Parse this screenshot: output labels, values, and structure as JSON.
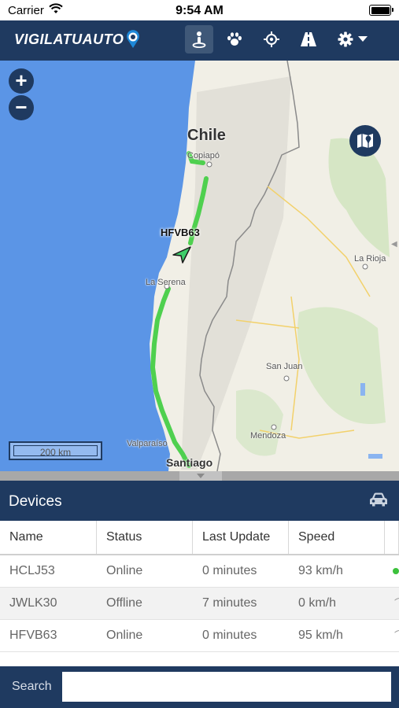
{
  "status_bar": {
    "carrier": "Carrier",
    "time": "9:54 AM"
  },
  "app": {
    "logo_text": "VIGILATUAUTO"
  },
  "nav": {
    "icons": [
      "tracking-person-icon",
      "paw-icon",
      "crosshair-icon",
      "road-icon",
      "gear-icon",
      "caret-down-icon"
    ],
    "active": "tracking-person-icon"
  },
  "map": {
    "zoom_in": "+",
    "zoom_out": "−",
    "scale_label": "200 km",
    "labels": {
      "chile": "Chile",
      "copiapo": "Copiapó",
      "la_serena": "La Serena",
      "la_rioja": "La Rioja",
      "san_juan": "San Juan",
      "mendoza": "Mendoza",
      "valparaiso": "Valparaíso",
      "santiago": "Santiago"
    },
    "vehicle_label": "HFVB63"
  },
  "devices": {
    "title": "Devices",
    "columns": [
      "Name",
      "Status",
      "Last Update",
      "Speed"
    ],
    "rows": [
      {
        "name": "HCLJ53",
        "status": "Online",
        "last_update": "0 minutes",
        "speed": "93 km/h"
      },
      {
        "name": "JWLK30",
        "status": "Offline",
        "last_update": "7 minutes",
        "speed": "0 km/h"
      },
      {
        "name": "HFVB63",
        "status": "Online",
        "last_update": "0 minutes",
        "speed": "95 km/h"
      }
    ]
  },
  "search": {
    "label": "Search",
    "value": "",
    "placeholder": ""
  },
  "colors": {
    "navy": "#1f3a60",
    "ocean": "#5b95e6",
    "land": "#f1efe6",
    "route": "#4fd04f"
  }
}
